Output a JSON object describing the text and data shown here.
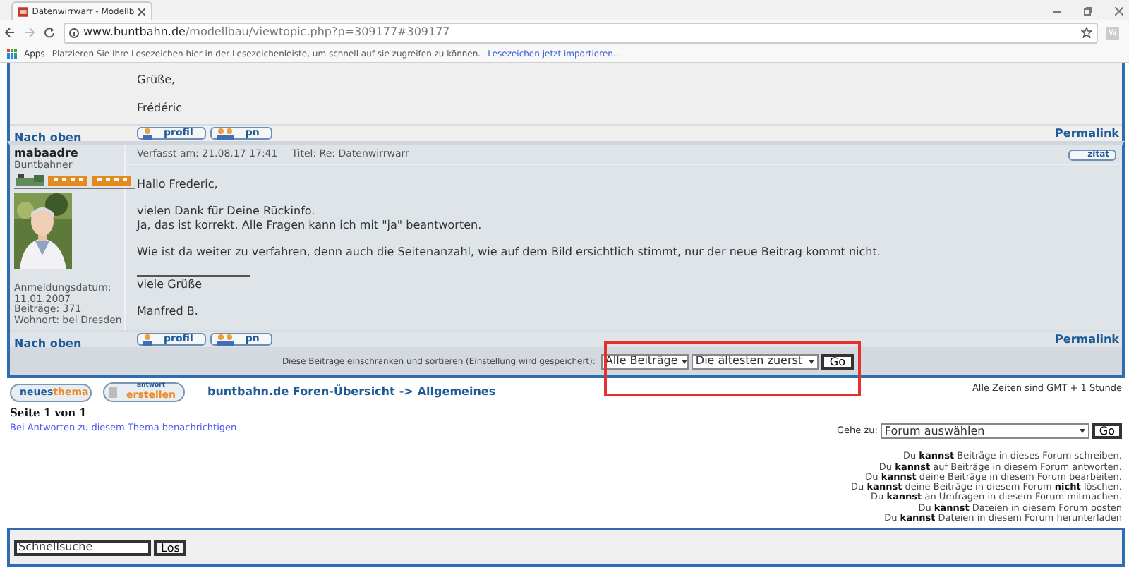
{
  "browser": {
    "tab_title": "Datenwirrwarr - Modellb",
    "url_host": "www.buntbahn.de",
    "url_path": "/modellbau/viewtopic.php?p=309177#309177",
    "extension": "W",
    "bookmarks": {
      "apps": "Apps",
      "hint": "Platzieren Sie Ihre Lesezeichen hier in der Lesezeichenleiste, um schnell auf sie zugreifen zu können.",
      "import_link": "Lesezeichen jetzt importieren..."
    }
  },
  "previous_post": {
    "lines": [
      "Grüße,",
      "Frédéric"
    ],
    "back_to_top": "Nach oben",
    "buttons": [
      "profil",
      "pn"
    ],
    "permalink": "Permalink"
  },
  "post": {
    "author": "mabaadre",
    "rank": "Buntbahner",
    "meta": [
      "Anmeldungsdatum:",
      "11.01.2007",
      "Beiträge: 371",
      "Wohnort: bei Dresden"
    ],
    "posted": "Verfasst am: 21.08.17 17:41",
    "title": "Titel: Re: Datenwirrwarr",
    "quote_button": "zitat",
    "body": [
      {
        "kind": "text",
        "lines": [
          "Hallo Frederic,"
        ]
      },
      {
        "kind": "text",
        "lines": [
          "vielen Dank für Deine Rückinfo.",
          "Ja, das ist korrekt. Alle Fragen kann ich mit \"ja\" beantworten."
        ]
      },
      {
        "kind": "text",
        "lines": [
          "Wie ist da weiter zu verfahren, denn auch die Seitenanzahl, wie auf dem Bild ersichtlich stimmt, nur der neue Beitrag kommt nicht."
        ]
      },
      {
        "kind": "rule"
      },
      {
        "kind": "text",
        "lines": [
          "viele Grüße"
        ]
      },
      {
        "kind": "text",
        "lines": [
          "Manfred B."
        ]
      }
    ],
    "back_to_top": "Nach oben",
    "buttons": [
      "profil",
      "pn"
    ],
    "permalink": "Permalink"
  },
  "sort_bar": {
    "label": "Diese Beiträge einschränken und sortieren (Einstellung wird gespeichert):",
    "selects": [
      "Alle Beiträge",
      "Die ältesten zuerst"
    ],
    "go": "Go"
  },
  "footer": {
    "new_topic": [
      "neues",
      "thema"
    ],
    "reply": [
      "antwort",
      "erstellen"
    ],
    "breadcrumb": [
      "buntbahn.de Foren-Übersicht",
      "->",
      "Allgemeines"
    ],
    "timezone": "Alle Zeiten sind GMT + 1 Stunde",
    "page": "Seite 1 von 1",
    "notify": "Bei Antworten zu diesem Thema benachrichtigen",
    "jump": {
      "label": "Gehe zu:",
      "select": "Forum auswählen",
      "go": "Go"
    },
    "permissions": [
      "Du **kannst** Beiträge in dieses Forum schreiben.",
      "Du **kannst** auf Beiträge in diesem Forum antworten.",
      "Du **kannst** deine Beiträge in diesem Forum bearbeiten.",
      "Du **kannst** deine Beiträge in diesem Forum **nicht** löschen.",
      "Du **kannst** an Umfragen in diesem Forum mitmachen.",
      "Du **kannst** Dateien in diesem Forum posten",
      "Du **kannst** Dateien in diesem Forum herunterladen"
    ]
  },
  "quick_search": {
    "value": "Schnellsuche",
    "button": "Los"
  }
}
